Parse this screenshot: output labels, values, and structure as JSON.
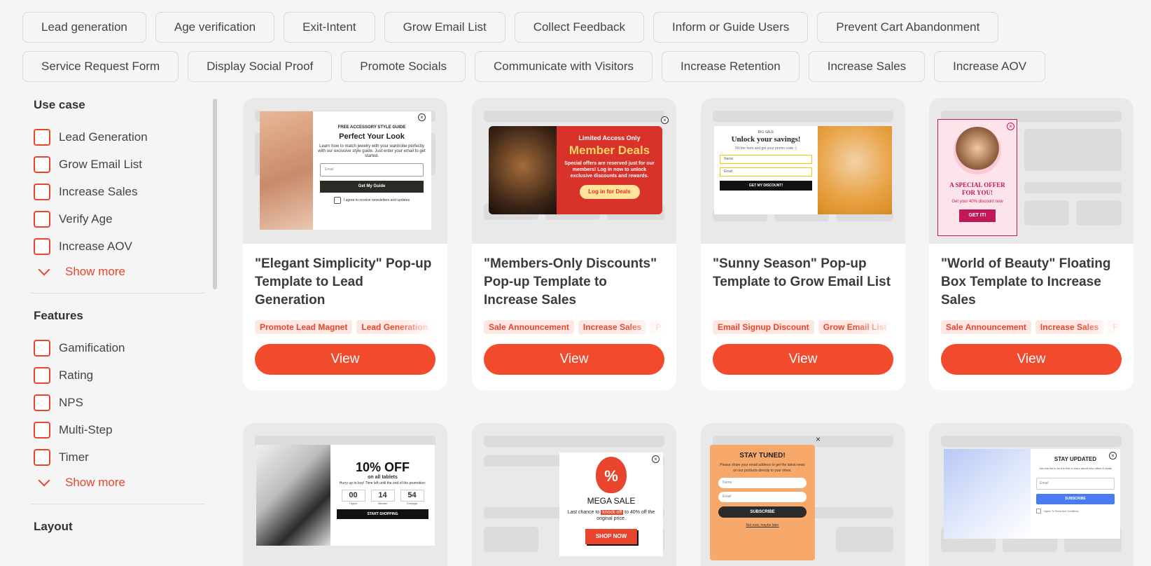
{
  "filter_chips_row1": [
    "Lead generation",
    "Age verification",
    "Exit-Intent",
    "Grow Email List",
    "Collect Feedback",
    "Inform or Guide Users",
    "Prevent Cart Abandonment"
  ],
  "filter_chips_row2": [
    "Service Request Form",
    "Display Social Proof",
    "Promote Socials",
    "Communicate with Visitors",
    "Increase Retention",
    "Increase Sales",
    "Increase AOV"
  ],
  "sidebar": {
    "use_case_title": "Use case",
    "use_case_items": [
      "Lead Generation",
      "Grow Email List",
      "Increase Sales",
      "Verify Age",
      "Increase AOV"
    ],
    "show_more": "Show more",
    "features_title": "Features",
    "features_items": [
      "Gamification",
      "Rating",
      "NPS",
      "Multi-Step",
      "Timer"
    ],
    "layout_title": "Layout"
  },
  "cards": [
    {
      "title": "\"Elegant Simplicity\" Pop-up Template to Lead Generation",
      "tags": [
        "Promote Lead Magnet",
        "Lead Generation"
      ],
      "view": "View",
      "popup": {
        "kicker": "FREE ACCESSORY STYLE GUIDE",
        "heading": "Perfect Your Look",
        "text": "Learn how to match jewelry with your wardrobe perfectly with our exclusive style guide. Just enter your email to get started.",
        "email_placeholder": "Email",
        "button": "Get My Guide",
        "consent": "I agree to receive newsletters and updates"
      }
    },
    {
      "title": "\"Members-Only Discounts\" Pop-up Template to Increase Sales",
      "tags": [
        "Sale Announcement",
        "Increase Sales",
        "P"
      ],
      "view": "View",
      "popup": {
        "kicker": "Limited Access Only",
        "heading": "Member Deals",
        "text": "Special offers are reserved just for our members! Log in now to unlock exclusive discounts and rewards.",
        "button": "Log in for Deals"
      }
    },
    {
      "title": "\"Sunny Season\" Pop-up Template to Grow Email List",
      "tags": [
        "Email Signup Discount",
        "Grow Email List"
      ],
      "view": "View",
      "popup": {
        "kicker": "BIG SALE",
        "heading": "Unlock your savings!",
        "text": "Fill the form and get your promo code :)",
        "name_placeholder": "Name",
        "email_placeholder": "Email",
        "button": "GET MY DISCOUNT!"
      }
    },
    {
      "title": "\"World of Beauty\" Floating Box Template to Increase Sales",
      "tags": [
        "Sale Announcement",
        "Increase Sales",
        "F"
      ],
      "view": "View",
      "popup": {
        "heading": "A SPECIAL OFFER FOR YOU!",
        "text": "Get your 40% discount now",
        "button": "GET IT!"
      }
    }
  ],
  "bottom_cards": [
    {
      "heading": "10% OFF",
      "sub": "on all tablets",
      "text": "Hurry up to buy! Time left until the end of the promotion:",
      "timer": [
        "00",
        "14",
        "54"
      ],
      "timer_labels": [
        "Годин",
        "Хвилин",
        "Секунди"
      ],
      "button": "START SHOPPING"
    },
    {
      "heading": "MEGA SALE",
      "text_before": "Last chance to",
      "highlight": "knock off",
      "text_after": "to 40% off the original price.",
      "button": "SHOP NOW"
    },
    {
      "heading": "STAY TUNED!",
      "text": "Please share your email address to get the latest news on our products directly to your inbox.",
      "name_placeholder": "Name",
      "email_placeholder": "Email",
      "button": "SUBSCRIBE",
      "link": "Not now, maybe later"
    },
    {
      "heading": "STAY UPDATED",
      "text": "Join the list to be the first to learn about new offers & deals",
      "email_placeholder": "Email",
      "button": "SUBSCRIBE",
      "consent": "I Agree To Terms And Conditions"
    }
  ],
  "colors": {
    "accent": "#f24a2c",
    "tag_bg": "#fde7e3",
    "red_popup": "#d9322a",
    "pink_popup": "#c2185b",
    "orange_popup": "#f7a96b"
  }
}
